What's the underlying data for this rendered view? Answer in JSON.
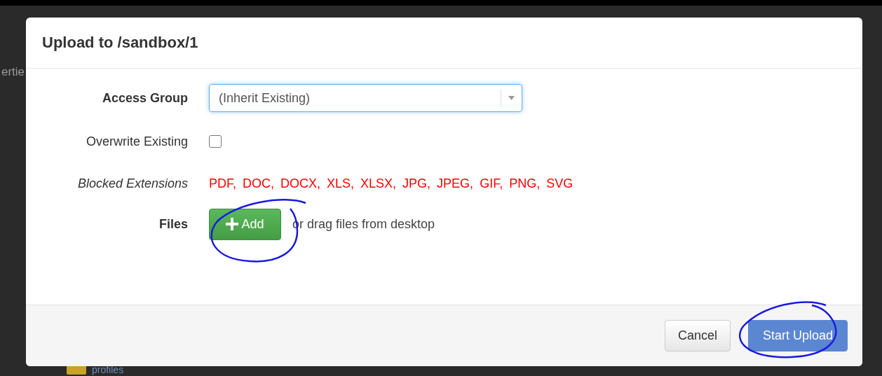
{
  "background": {
    "fragments": [
      {
        "text": "ertie"
      }
    ],
    "folder": {
      "label": "profiles"
    }
  },
  "dialog": {
    "title": "Upload to /sandbox/1",
    "fields": [
      {
        "kind": "select",
        "label": "Access Group",
        "value": "(Inherit Existing)"
      },
      {
        "kind": "checkbox",
        "label": "Overwrite Existing",
        "checked": false
      },
      {
        "kind": "extensions",
        "label": "Blocked Extensions",
        "items": [
          "PDF,",
          "DOC,",
          "DOCX,",
          "XLS,",
          "XLSX,",
          "JPG,",
          "JPEG,",
          "GIF,",
          "PNG,",
          "SVG"
        ]
      },
      {
        "kind": "files",
        "label": "Files",
        "button": "Add",
        "hint": "or drag files from desktop"
      }
    ],
    "buttons": [
      {
        "label": "Cancel",
        "kind": "secondary"
      },
      {
        "label": "Start Upload",
        "kind": "primary"
      }
    ]
  }
}
